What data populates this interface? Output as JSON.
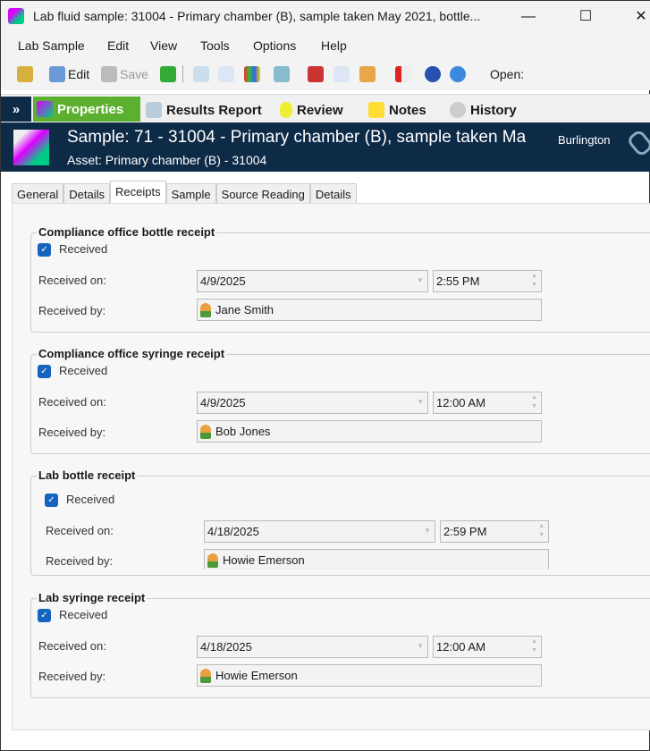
{
  "window": {
    "title": "Lab fluid sample: 31004 - Primary chamber (B), sample taken May 2021, bottle...",
    "minimize": "—",
    "maximize": "☐",
    "close": "✕"
  },
  "menu": [
    "Lab Sample",
    "Edit",
    "View",
    "Tools",
    "Options",
    "Help"
  ],
  "toolbar": {
    "edit": "Edit",
    "save": "Save",
    "open": "Open:"
  },
  "nav": {
    "collapse": "»",
    "properties": "Properties",
    "results": "Results Report",
    "review": "Review",
    "notes": "Notes",
    "history": "History"
  },
  "header": {
    "title": "Sample: 71 - 31004 - Primary chamber (B), sample taken Ma",
    "subtitle": "Asset: Primary chamber (B) - 31004",
    "location": "Burlington"
  },
  "tabs": [
    "General",
    "Details",
    "Receipts",
    "Sample",
    "Source Reading",
    "Details"
  ],
  "active_tab": "Receipts",
  "labels": {
    "received": "Received",
    "received_on": "Received on:",
    "received_by": "Received by:"
  },
  "groups": [
    {
      "title": "Compliance office bottle receipt",
      "received": true,
      "date": "4/9/2025",
      "time": "2:55 PM",
      "by": "Jane Smith"
    },
    {
      "title": "Compliance office syringe receipt",
      "received": true,
      "date": "4/9/2025",
      "time": "12:00 AM",
      "by": "Bob Jones"
    },
    {
      "title": "Lab bottle receipt",
      "received": true,
      "date": "4/18/2025",
      "time": "2:59 PM",
      "by": "Howie Emerson"
    },
    {
      "title": "Lab syringe receipt",
      "received": true,
      "date": "4/18/2025",
      "time": "12:00 AM",
      "by": "Howie Emerson"
    }
  ]
}
